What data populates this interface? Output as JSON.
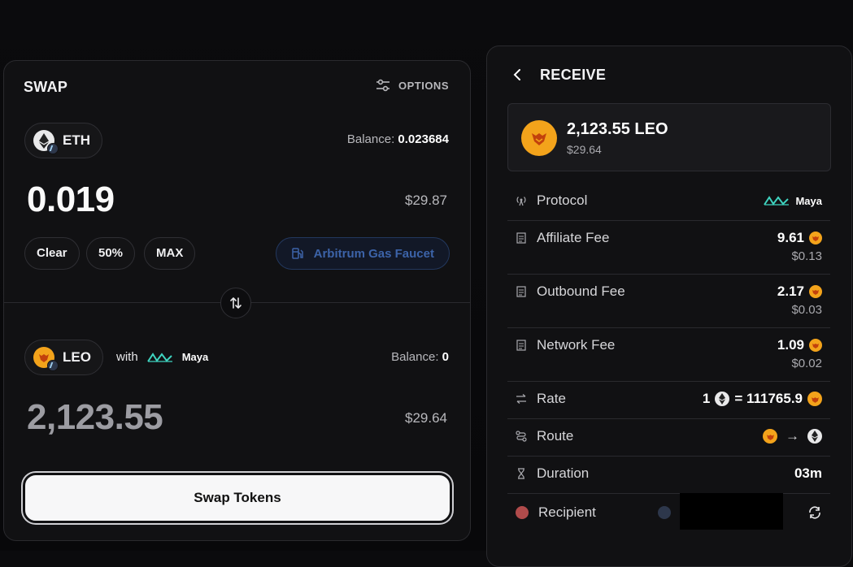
{
  "swap": {
    "title": "SWAP",
    "options_label": "OPTIONS",
    "from": {
      "token": "ETH",
      "balance_label": "Balance:",
      "balance": "0.023684",
      "amount": "0.019",
      "usd": "$29.87"
    },
    "quick": [
      "Clear",
      "50%",
      "MAX"
    ],
    "faucet_label": "Arbitrum Gas Faucet",
    "to": {
      "token": "LEO",
      "with_label": "with",
      "provider": "Maya",
      "balance_label": "Balance:",
      "balance": "0",
      "amount": "2,123.55",
      "usd": "$29.64"
    },
    "swap_button": "Swap Tokens"
  },
  "receive": {
    "title": "RECEIVE",
    "amount": "2,123.55 LEO",
    "usd": "$29.64",
    "rows": {
      "protocol": {
        "label": "Protocol",
        "value": "Maya"
      },
      "affiliate": {
        "label": "Affiliate Fee",
        "value": "9.61",
        "usd": "$0.13"
      },
      "outbound": {
        "label": "Outbound Fee",
        "value": "2.17",
        "usd": "$0.03"
      },
      "network": {
        "label": "Network Fee",
        "value": "1.09",
        "usd": "$0.02"
      },
      "rate": {
        "label": "Rate",
        "left": "1",
        "eq": "= 111765.9"
      },
      "route": {
        "label": "Route",
        "arrow": "→"
      },
      "duration": {
        "label": "Duration",
        "value": "03m"
      },
      "recipient": {
        "label": "Recipient"
      }
    }
  },
  "colors": {
    "accent_leo": "#f3a31b",
    "maya_teal": "#3fd4c0",
    "faucet_blue": "#3c63a8",
    "panel_bg": "#111113"
  },
  "icons": [
    "options-sliders-icon",
    "eth-icon",
    "arbitrum-icon",
    "leo-icon",
    "maya-logo",
    "gas-pump-icon",
    "swap-arrows-icon",
    "chevron-left-icon",
    "antenna-icon",
    "document-icon",
    "exchange-icon",
    "route-icon",
    "hourglass-icon",
    "refresh-icon"
  ]
}
